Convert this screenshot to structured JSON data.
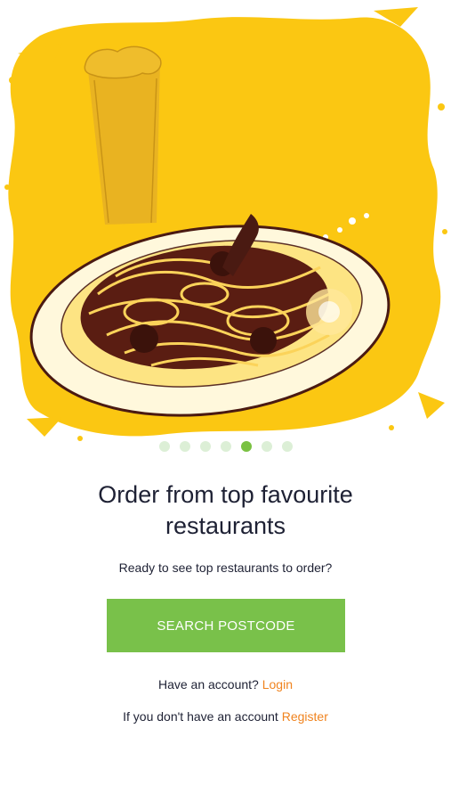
{
  "carousel": {
    "slide_count": 7,
    "active_index": 4,
    "active_color": "#7ac142",
    "inactive_color": "#dcefd6"
  },
  "hero": {
    "illustration": "pasta-plate-with-beer-illustration",
    "background_color": "#fbc712"
  },
  "onboarding": {
    "headline": "Order from top favourite restaurants",
    "subtext": "Ready to see top restaurants to order?",
    "cta_label": "SEARCH POSTCODE",
    "cta_color": "#79c14a"
  },
  "account": {
    "login_prompt": "Have an account?",
    "login_link": "Login",
    "register_prompt": "If you don't have an account",
    "register_link": "Register",
    "link_color": "#f0831e"
  }
}
